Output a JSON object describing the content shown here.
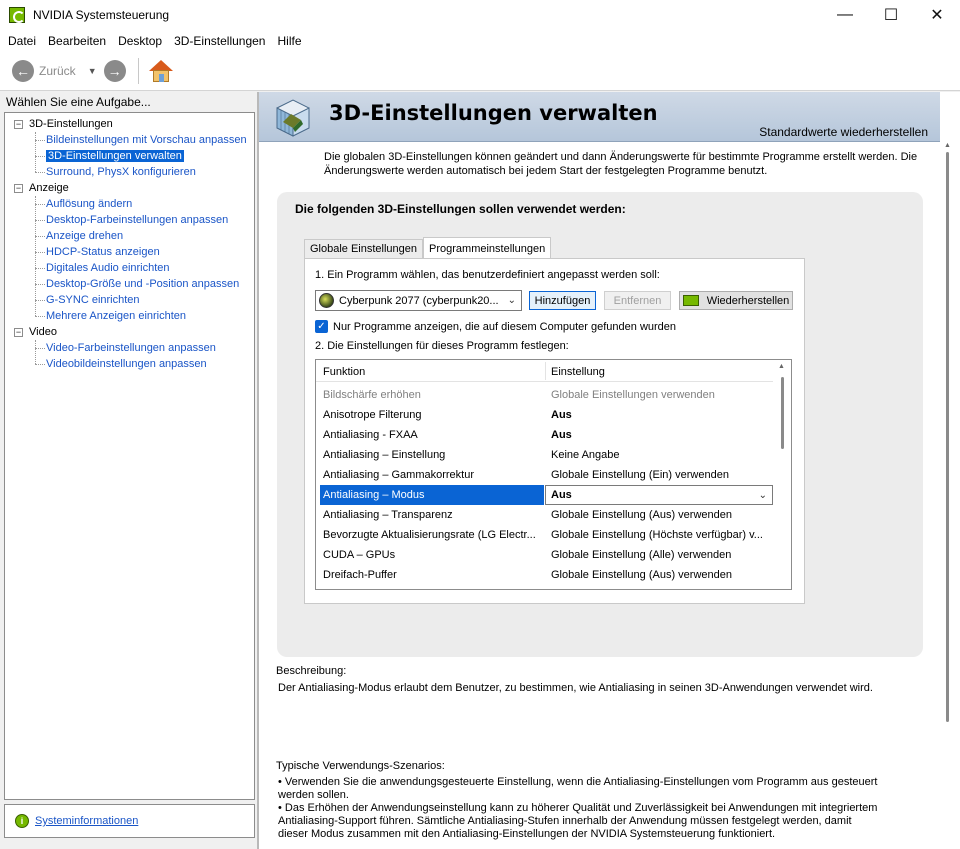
{
  "window": {
    "title": "NVIDIA Systemsteuerung",
    "controls": {
      "minimize": "—",
      "maximize": "☐",
      "close": "✕"
    }
  },
  "menu": [
    "Datei",
    "Bearbeiten",
    "Desktop",
    "3D-Einstellungen",
    "Hilfe"
  ],
  "toolbar": {
    "back_label": "Zurück"
  },
  "sidebar": {
    "heading": "Wählen Sie eine Aufgabe...",
    "categories": [
      {
        "label": "3D-Einstellungen",
        "items": [
          "Bildeinstellungen mit Vorschau anpassen",
          "3D-Einstellungen verwalten",
          "Surround, PhysX konfigurieren"
        ]
      },
      {
        "label": "Anzeige",
        "items": [
          "Auflösung ändern",
          "Desktop-Farbeinstellungen anpassen",
          "Anzeige drehen",
          "HDCP-Status anzeigen",
          "Digitales Audio einrichten",
          "Desktop-Größe und -Position anpassen",
          "G-SYNC einrichten",
          "Mehrere Anzeigen einrichten"
        ]
      },
      {
        "label": "Video",
        "items": [
          "Video-Farbeinstellungen anpassen",
          "Videobildeinstellungen anpassen"
        ]
      }
    ],
    "selected": "3D-Einstellungen verwalten",
    "system_info": "Systeminformationen"
  },
  "main": {
    "title": "3D-Einstellungen verwalten",
    "restore_defaults": "Standardwerte wiederherstellen",
    "intro": "Die globalen 3D-Einstellungen können geändert und dann Änderungswerte für bestimmte Programme erstellt werden. Die Änderungswerte werden automatisch bei jedem Start der festgelegten Programme benutzt.",
    "panel_heading": "Die folgenden 3D-Einstellungen sollen verwendet werden:",
    "tabs": [
      "Globale Einstellungen",
      "Programmeinstellungen"
    ],
    "active_tab": "Programmeinstellungen",
    "step1_label": "1. Ein Programm wählen, das benutzerdefiniert angepasst werden soll:",
    "selected_program": "Cyberpunk 2077 (cyberpunk20...",
    "buttons": {
      "add": "Hinzufügen",
      "remove": "Entfernen",
      "restore": "Wiederherstellen"
    },
    "checkbox_label": "Nur Programme anzeigen, die auf diesem Computer gefunden wurden",
    "step2_label": "2. Die Einstellungen für dieses Programm festlegen:",
    "grid": {
      "headers": [
        "Funktion",
        "Einstellung"
      ],
      "rows": [
        {
          "function": "Bildschärfe erhöhen",
          "setting": "Globale Einstellungen verwenden"
        },
        {
          "function": "Anisotrope Filterung",
          "setting": "Aus"
        },
        {
          "function": "Antialiasing - FXAA",
          "setting": "Aus"
        },
        {
          "function": "Antialiasing – Einstellung",
          "setting": "Keine Angabe"
        },
        {
          "function": "Antialiasing – Gammakorrektur",
          "setting": "Globale Einstellung (Ein) verwenden"
        },
        {
          "function": "Antialiasing – Modus",
          "setting": "Aus"
        },
        {
          "function": "Antialiasing – Transparenz",
          "setting": "Globale Einstellung (Aus) verwenden"
        },
        {
          "function": "Bevorzugte Aktualisierungsrate (LG Electr...",
          "setting": "Globale Einstellung (Höchste verfügbar) v..."
        },
        {
          "function": "CUDA – GPUs",
          "setting": "Globale Einstellung (Alle) verwenden"
        },
        {
          "function": "Dreifach-Puffer",
          "setting": "Globale Einstellung (Aus) verwenden"
        }
      ]
    },
    "description_title": "Beschreibung:",
    "description_text": "Der Antialiasing-Modus erlaubt dem Benutzer, zu bestimmen, wie Antialiasing in seinen 3D-Anwendungen verwendet wird.",
    "usage_title": "Typische Verwendungs-Szenarios:",
    "usage_items": [
      "• Verwenden Sie die anwendungsgesteuerte Einstellung, wenn die Antialiasing-Einstellungen vom Programm aus gesteuert werden sollen.",
      "• Das Erhöhen der Anwendungseinstellung kann zu höherer Qualität und Zuverlässigkeit bei Anwendungen mit integriertem Antialiasing-Support führen. Sämtliche Antialiasing-Stufen innerhalb der Anwendung müssen festgelegt werden, damit dieser Modus zusammen mit den Antialiasing-Einstellungen der NVIDIA Systemsteuerung funktioniert."
    ]
  },
  "colors": {
    "accent": "#0a64d4",
    "link": "#1a55c7",
    "nvidia_green": "#76b900"
  }
}
